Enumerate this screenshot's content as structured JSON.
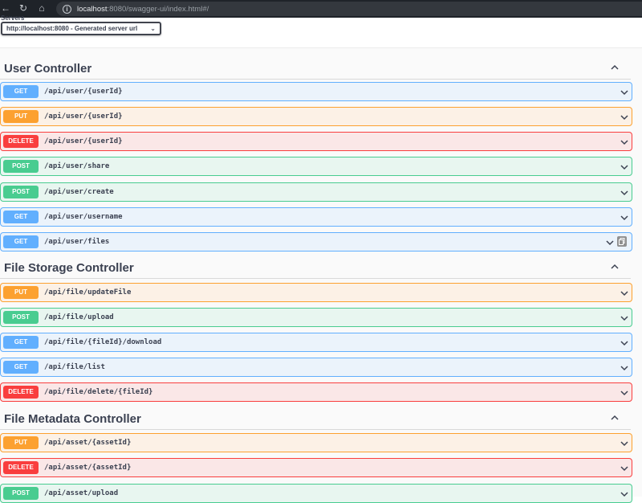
{
  "browser": {
    "url_host": "localhost",
    "url_rest": ":8080/swagger-ui/index.html#/"
  },
  "servers": {
    "label": "Servers",
    "selected": "http://localhost:8080 - Generated server url"
  },
  "sections": [
    {
      "title": "User Controller",
      "ops": [
        {
          "method": "GET",
          "path": "/api/user/{userId}"
        },
        {
          "method": "PUT",
          "path": "/api/user/{userId}"
        },
        {
          "method": "DELETE",
          "path": "/api/user/{userId}"
        },
        {
          "method": "POST",
          "path": "/api/user/share"
        },
        {
          "method": "POST",
          "path": "/api/user/create"
        },
        {
          "method": "GET",
          "path": "/api/user/username"
        },
        {
          "method": "GET",
          "path": "/api/user/files"
        }
      ]
    },
    {
      "title": "File Storage Controller",
      "ops": [
        {
          "method": "PUT",
          "path": "/api/file/updateFile"
        },
        {
          "method": "POST",
          "path": "/api/file/upload"
        },
        {
          "method": "GET",
          "path": "/api/file/{fileId}/download"
        },
        {
          "method": "GET",
          "path": "/api/file/list"
        },
        {
          "method": "DELETE",
          "path": "/api/file/delete/{fileId}"
        }
      ]
    },
    {
      "title": "File Metadata Controller",
      "ops": [
        {
          "method": "PUT",
          "path": "/api/asset/{assetId}"
        },
        {
          "method": "DELETE",
          "path": "/api/asset/{assetId}"
        },
        {
          "method": "POST",
          "path": "/api/asset/upload"
        }
      ]
    }
  ],
  "colors": {
    "get": "#61affe",
    "put": "#fca130",
    "delete": "#f93e3e",
    "post": "#49cc90"
  }
}
